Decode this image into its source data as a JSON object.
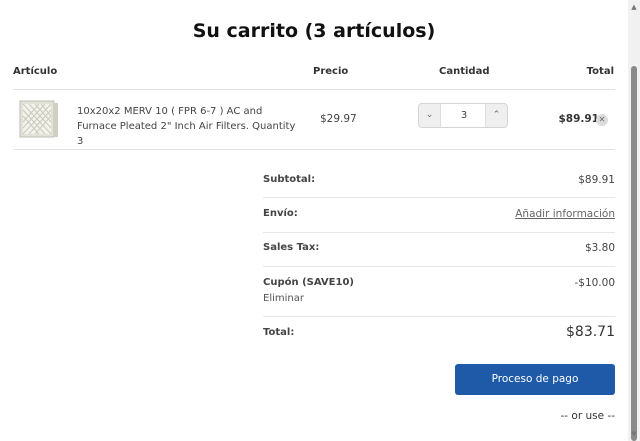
{
  "page": {
    "title": "Su carrito (3 artículos)"
  },
  "table": {
    "headers": {
      "item": "Artículo",
      "price": "Precio",
      "qty": "Cantidad",
      "total": "Total"
    },
    "rows": [
      {
        "name": "10x20x2 MERV 10 ( FPR 6-7 ) AC and Furnace Pleated 2\" Inch Air Filters. Quantity 3",
        "price": "$29.97",
        "quantity": "3",
        "total": "$89.91",
        "image_icon": "air-filter-image"
      }
    ]
  },
  "summary": {
    "subtotal_label": "Subtotal:",
    "subtotal_value": "$89.91",
    "shipping_label": "Envío:",
    "shipping_link": "Añadir información",
    "tax_label": "Sales Tax:",
    "tax_value": "$3.80",
    "coupon_label": "Cupón (SAVE10)",
    "coupon_remove": "Eliminar",
    "coupon_value": "-$10.00",
    "total_label": "Total:",
    "total_value": "$83.71"
  },
  "checkout": {
    "button_label": "Proceso de pago",
    "or_use": "-- or use --"
  },
  "colors": {
    "checkout_button": "#1e5aa8"
  }
}
